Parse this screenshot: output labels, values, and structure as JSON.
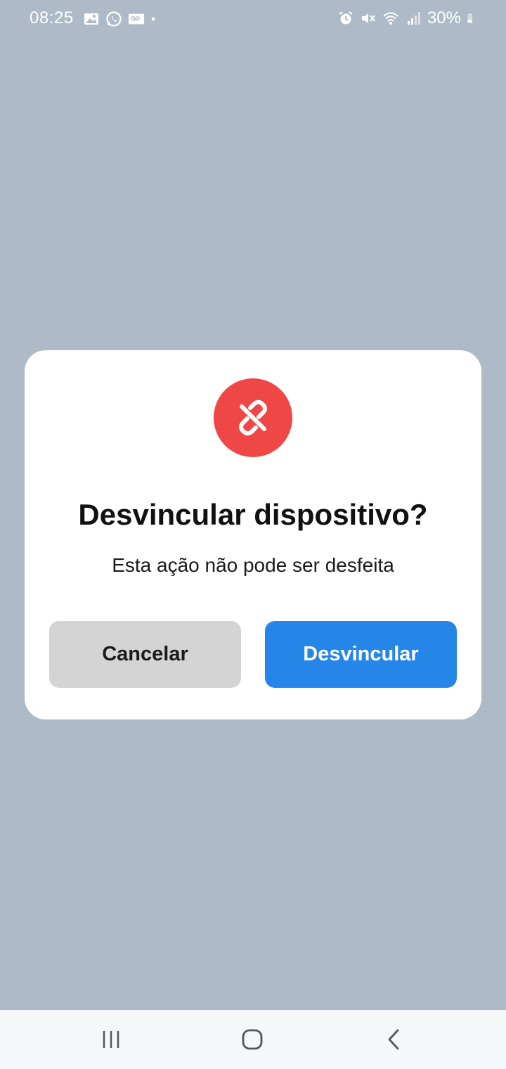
{
  "status_bar": {
    "time": "08:25",
    "battery_percent": "30%",
    "left_icons": [
      "gallery-icon",
      "whatsapp-icon",
      "voicemail-icon",
      "dot-icon"
    ],
    "right_icons": [
      "alarm-icon",
      "mute-icon",
      "wifi-icon",
      "signal-icon",
      "battery-icon"
    ]
  },
  "dialog": {
    "icon": "unlink-icon",
    "icon_color": "#ef4646",
    "title": "Desvincular dispositivo?",
    "subtitle": "Esta ação não pode ser desfeita",
    "cancel_label": "Cancelar",
    "confirm_label": "Desvincular",
    "confirm_color": "#2586e8",
    "cancel_color": "#d4d4d4"
  },
  "nav_bar": {
    "items": [
      "recents-icon",
      "home-icon",
      "back-icon"
    ]
  },
  "colors": {
    "backdrop": "#aebac8"
  }
}
